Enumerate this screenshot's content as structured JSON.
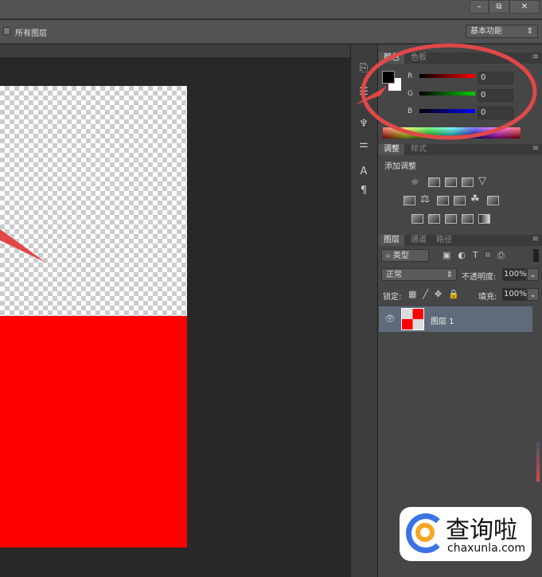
{
  "window": {
    "minimize": "–",
    "restore": "⧉",
    "close": "✕"
  },
  "options": {
    "all_layers_label": "所有图层",
    "workspace": "基本功能"
  },
  "color_panel": {
    "tabs": [
      "颜色",
      "色板"
    ],
    "channels": [
      {
        "label": "R",
        "value": "0"
      },
      {
        "label": "G",
        "value": "0"
      },
      {
        "label": "B",
        "value": "0"
      }
    ],
    "foreground": "#000000",
    "background": "#ffffff"
  },
  "adjust_panel": {
    "tabs": [
      "调整",
      "样式"
    ],
    "heading": "添加调整"
  },
  "layers_panel": {
    "tabs": [
      "图层",
      "通道",
      "路径"
    ],
    "filter": "类型",
    "blend_mode": "正常",
    "opacity_label": "不透明度:",
    "opacity": "100%",
    "lock_label": "锁定:",
    "fill_label": "填充:",
    "fill": "100%",
    "layers": [
      {
        "name": "图层 1",
        "visible": true
      }
    ]
  },
  "watermark": {
    "brand": "查询啦",
    "domain": "chaxunla.com"
  },
  "colors": {
    "annotation": "#e04848",
    "canvas_fill": "#ff0000"
  }
}
